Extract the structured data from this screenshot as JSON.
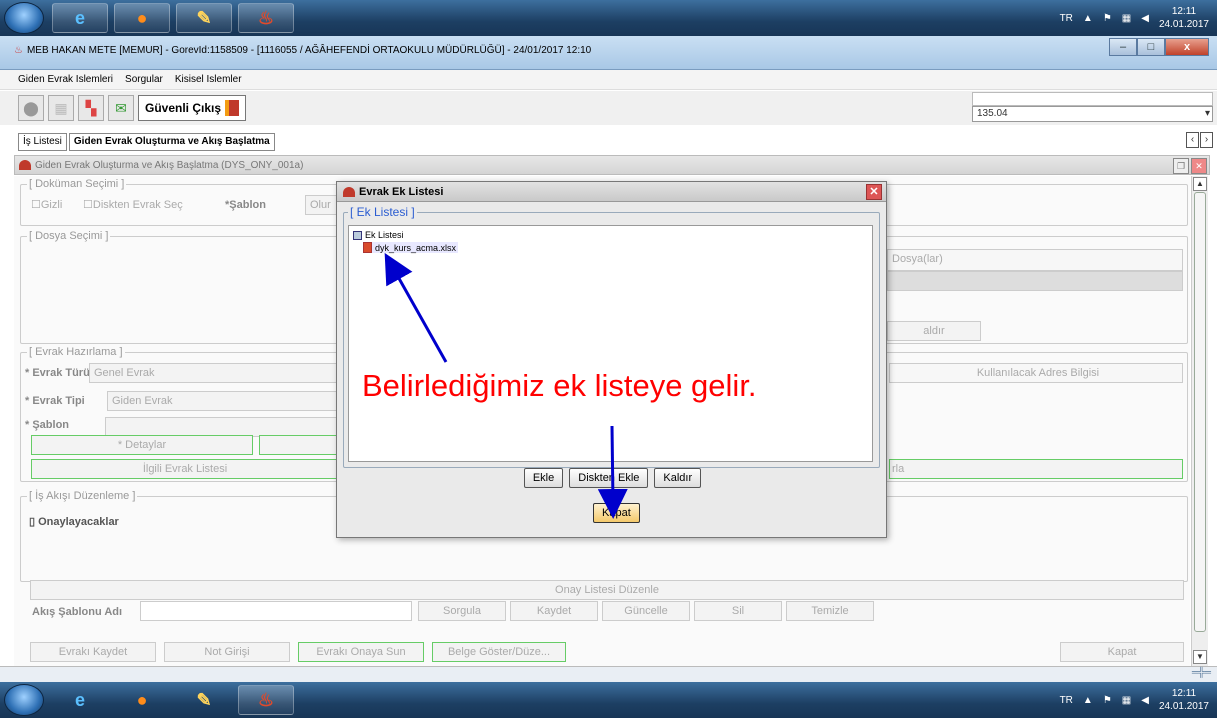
{
  "taskbar": {
    "lang": "TR",
    "time": "12:11",
    "date": "24.01.2017"
  },
  "window": {
    "title": "MEB   HAKAN METE  [MEMUR] - GorevId:1158509 - [1116055 / AĞÂHEFENDİ ORTAOKULU MÜDÜRLÜĞÜ] - 24/01/2017 12:10",
    "minimize": "–",
    "maximize": "□",
    "close": "x"
  },
  "menu": [
    "Giden Evrak Islemleri",
    "Sorgular",
    "Kisisel Islemler"
  ],
  "toolbar": {
    "safe_exit": "Güvenli Çıkış",
    "combo_value": "135.04"
  },
  "tabs": [
    "İş Listesi",
    "Giden Evrak Oluşturma ve Akış Başlatma"
  ],
  "panel": {
    "title": "Giden Evrak Oluşturma ve Akış Başlatma (DYS_ONY_001a)"
  },
  "form": {
    "doc_legend": "[ Doküman Seçimi ]",
    "gizli": "Gizli",
    "diskten": "Diskten Evrak Seç",
    "sablon_lbl": "*Şablon",
    "olur": "Olur",
    "dosya_legend": "[ Dosya Seçimi ]",
    "dosyalar_header": "Dosya(lar)",
    "kaldir_partial": "aldır",
    "evrak_legend": "[ Evrak Hazırlama ]",
    "evrak_turu_lbl": "* Evrak Türü",
    "evrak_turu_val": "Genel Evrak",
    "evrak_tipi_lbl": "* Evrak Tipi",
    "evrak_tipi_val": "Giden Evrak",
    "sablon2_lbl": "* Şablon",
    "detaylar": "* Detaylar",
    "ilgili": "İlgili Evrak Listesi",
    "adres": "Kullanılacak Adres Bilgisi",
    "rla_partial": "rla",
    "is_akisi_legend": "[ İş Akışı Düzenleme ]",
    "onaylayacaklar": "Onaylayacaklar",
    "onay_listesi": "Onay Listesi Düzenle",
    "akis_sablonu": "Akış Şablonu Adı",
    "sorgula": "Sorgula",
    "kaydet": "Kaydet",
    "guncelle": "Güncelle",
    "sil": "Sil",
    "temizle": "Temizle",
    "evraki_kaydet": "Evrakı Kaydet",
    "not_girisi": "Not Girişi",
    "evraki_onaya": "Evrakı Onaya Sun",
    "belge_goster": "Belge Göster/Düze...",
    "kapat": "Kapat"
  },
  "dialog": {
    "title": "Evrak Ek Listesi",
    "legend": "[ Ek Listesi ]",
    "tree_root": "Ek Listesi",
    "file": "dyk_kurs_acma.xlsx",
    "ekle": "Ekle",
    "diskten_ekle": "Diskten Ekle",
    "kaldir": "Kaldır",
    "kapat": "Kapat"
  },
  "annotation": "Belirlediğimiz ek listeye gelir.",
  "colors": {
    "annotation": "#ff0000",
    "arrow": "#0000cc",
    "legend_blue": "#2a5cd1"
  }
}
